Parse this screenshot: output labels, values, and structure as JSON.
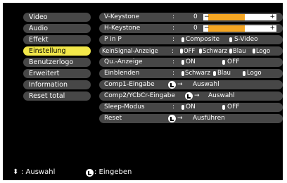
{
  "menu": [
    {
      "label": "Video",
      "active": false
    },
    {
      "label": "Audio",
      "active": false
    },
    {
      "label": "Effekt",
      "active": false
    },
    {
      "label": "Einstellung",
      "active": true
    },
    {
      "label": "Benutzerlogo",
      "active": false
    },
    {
      "label": "Erweitert",
      "active": false
    },
    {
      "label": "Information",
      "active": false
    },
    {
      "label": "Reset total",
      "active": false
    }
  ],
  "settings": {
    "vkeystone": {
      "label": "V-Keystone",
      "colon": ":",
      "value": "0",
      "level": 0.5
    },
    "hkeystone": {
      "label": "H-Keystone",
      "colon": ":",
      "value": "0",
      "level": 0.5
    },
    "pinp": {
      "label": "P in P",
      "colon": ":",
      "opt1": "Composite",
      "opt2": "S-Video"
    },
    "nosignal": {
      "label": "KeinSignal-Anzeige",
      "colon": ":",
      "opt1": "OFF",
      "opt2": "Schwarz",
      "opt3": "Blau",
      "opt4": "Logo"
    },
    "qu": {
      "label": "Qu.-Anzeige",
      "colon": ":",
      "opt1": "ON",
      "opt2": "OFF"
    },
    "einblenden": {
      "label": "Einblenden",
      "colon": ":",
      "opt1": "Schwarz",
      "opt2": "Blau",
      "opt3": "Logo"
    },
    "comp1": {
      "label": "Comp1-Eingabe",
      "arrow": "→",
      "action": "Auswahl"
    },
    "comp2": {
      "label": "Comp2/YCbCr-Eingabe",
      "arrow": "→",
      "action": "Auswahl"
    },
    "sleep": {
      "label": "Sleep-Modus",
      "colon": ":",
      "opt1": "ON",
      "opt2": "OFF"
    },
    "reset": {
      "label": "Reset",
      "arrow": "→",
      "action": "Ausführen"
    }
  },
  "footer": {
    "arrows": "⬍",
    "select_label": ": Auswahl",
    "enter_label": ": Eingeben"
  },
  "colors": {
    "active": "#f3e84a",
    "item": "#474747",
    "slider_fill": "#f5a623"
  }
}
